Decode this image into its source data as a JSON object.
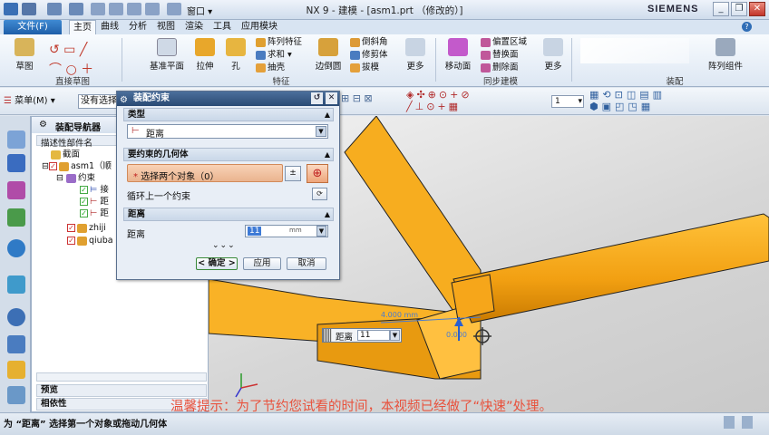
{
  "window": {
    "title": "NX 9 - 建模 - [asm1.prt （修改的）]",
    "brand": "SIEMENS",
    "window_menu": "窗口"
  },
  "menu": {
    "file": "文件(F)",
    "tabs": [
      "主页",
      "曲线",
      "分析",
      "视图",
      "渲染",
      "工具",
      "应用模块"
    ]
  },
  "ribbon": {
    "sketch": "草图",
    "direct_sketch_group": "直接草图",
    "datum_plane": "基准平面",
    "extrude": "拉伸",
    "hole": "孔",
    "pattern_feature": "阵列特征",
    "unite": "求和",
    "shell": "抽壳",
    "edge_blend": "边倒圆",
    "chamfer": "倒斜角",
    "trim_body": "修剪体",
    "draft": "拔模",
    "more": "更多",
    "feature_group": "特征",
    "move_face": "移动面",
    "offset_region": "偏置区域",
    "replace_face": "替换面",
    "delete_face": "删除面",
    "more2": "更多",
    "sync_group": "同步建模",
    "pattern_component": "阵列组件",
    "assembly_group": "装配"
  },
  "toolbar": {
    "menu": "菜单(M)",
    "filter": "没有选择",
    "spin_value": "1"
  },
  "navigator": {
    "title": "装配导航器",
    "col_name": "描述性部件名",
    "items": [
      {
        "label": "截面"
      },
      {
        "label": "asm1（顺"
      },
      {
        "label": "约束"
      },
      {
        "label": "接"
      },
      {
        "label": "距"
      },
      {
        "label": "距"
      },
      {
        "label": "zhiji"
      },
      {
        "label": "qiuba"
      }
    ],
    "preview": "预览",
    "dependency": "相依性"
  },
  "dialog": {
    "title": "装配约束",
    "type_section": "类型",
    "type_value": "距离",
    "geometry_section": "要约束的几何体",
    "select_objects": "选择两个对象（0）",
    "cycle_prev": "循环上一个约束",
    "distance_section": "距离",
    "distance_label": "距离",
    "distance_value": "11",
    "distance_unit": "mm",
    "ok": "< 确定 >",
    "apply": "应用",
    "cancel": "取消"
  },
  "viewport": {
    "distance_label": "距离",
    "distance_value": "11",
    "dim_text": "4.000 mm",
    "dim_text2": "0.000"
  },
  "status": "为 “距离” 选择第一个对象或拖动几何体",
  "watermark": "温馨提示：为了节约您试看的时间，本视频已经做了“快速”处理。"
}
